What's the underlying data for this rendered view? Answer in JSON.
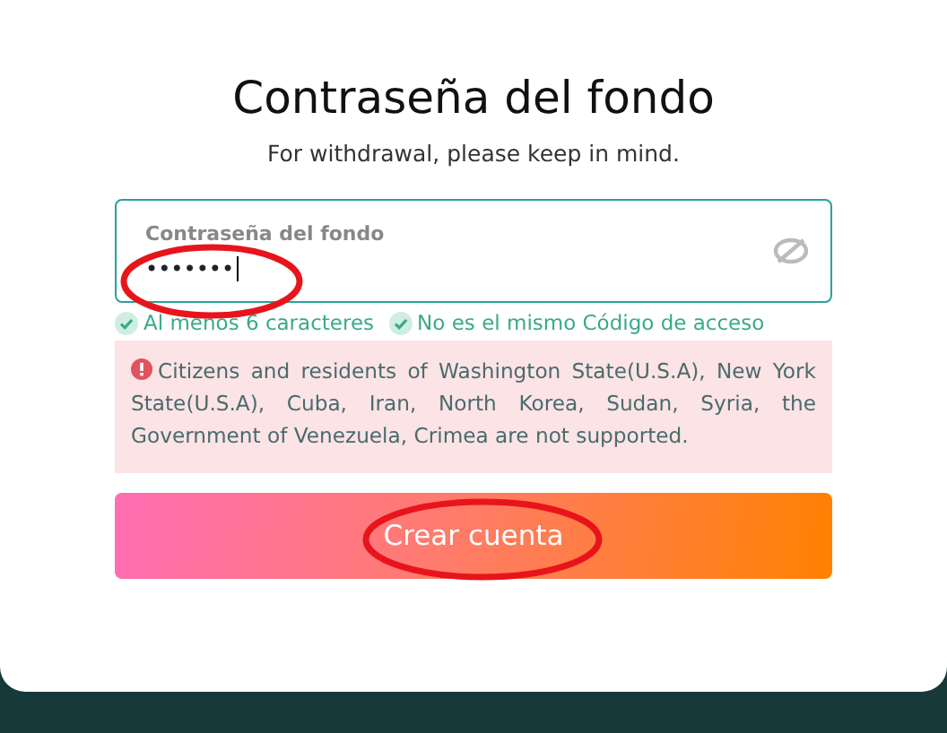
{
  "title": "Contraseña del fondo",
  "subtitle": "For withdrawal, please keep in mind.",
  "password_field": {
    "label": "Contraseña del fondo",
    "value": "•••••••",
    "focused": true
  },
  "requirements": [
    {
      "label": "Al menos 6 caracteres",
      "met": true
    },
    {
      "label": "No es el mismo Código de acceso",
      "met": true
    }
  ],
  "notice": "Citizens and residents of Washington State(U.S.A), New York State(U.S.A), Cuba, Iran, North Korea, Sudan, Syria, the Government of Venezuela, Crimea are not supported.",
  "submit_button": {
    "label": "Crear cuenta"
  }
}
